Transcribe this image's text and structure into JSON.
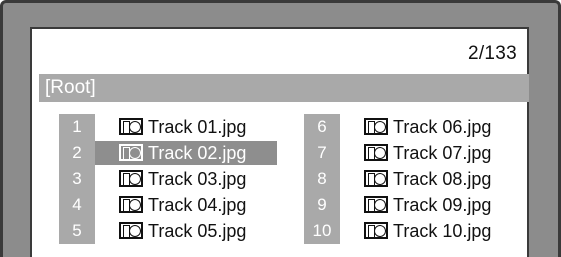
{
  "page_counter": "2/133",
  "folder": {
    "name": "[Root]"
  },
  "files_left": [
    {
      "num": "1",
      "name": "Track 01.jpg",
      "selected": false
    },
    {
      "num": "2",
      "name": "Track 02.jpg",
      "selected": true
    },
    {
      "num": "3",
      "name": "Track 03.jpg",
      "selected": false
    },
    {
      "num": "4",
      "name": "Track 04.jpg",
      "selected": false
    },
    {
      "num": "5",
      "name": "Track 05.jpg",
      "selected": false
    }
  ],
  "files_right": [
    {
      "num": "6",
      "name": "Track 06.jpg",
      "selected": false
    },
    {
      "num": "7",
      "name": "Track 07.jpg",
      "selected": false
    },
    {
      "num": "8",
      "name": "Track 08.jpg",
      "selected": false
    },
    {
      "num": "9",
      "name": "Track 09.jpg",
      "selected": false
    },
    {
      "num": "10",
      "name": "Track 10.jpg",
      "selected": false
    }
  ],
  "icon": "image-file-icon",
  "colors": {
    "bar": "#a9a9a9",
    "selected": "#8e8e8e",
    "bezel": "#8c8c8c"
  }
}
